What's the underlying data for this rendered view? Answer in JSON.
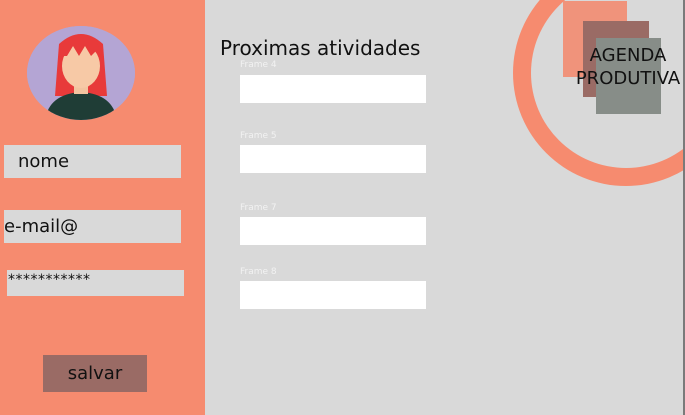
{
  "profile": {
    "avatar_icon": "avatar-woman-red-hair",
    "name_value": "nome",
    "email_value": "e-mail@",
    "password_value": "***********",
    "save_label": "salvar"
  },
  "activities": {
    "title": "Proximas atividades",
    "frames": [
      {
        "label": "Frame 4",
        "value": ""
      },
      {
        "label": "Frame 5",
        "value": ""
      },
      {
        "label": "Frame 7",
        "value": ""
      },
      {
        "label": "Frame 8",
        "value": ""
      }
    ]
  },
  "brand": {
    "line1": "AGENDA",
    "line2": "PRODUTIVA"
  },
  "colors": {
    "sidebar": "#f68b6f",
    "background": "#d9d9d9",
    "button": "#9a6b65",
    "input": "#d9d9d9",
    "frame": "#ffffff"
  }
}
